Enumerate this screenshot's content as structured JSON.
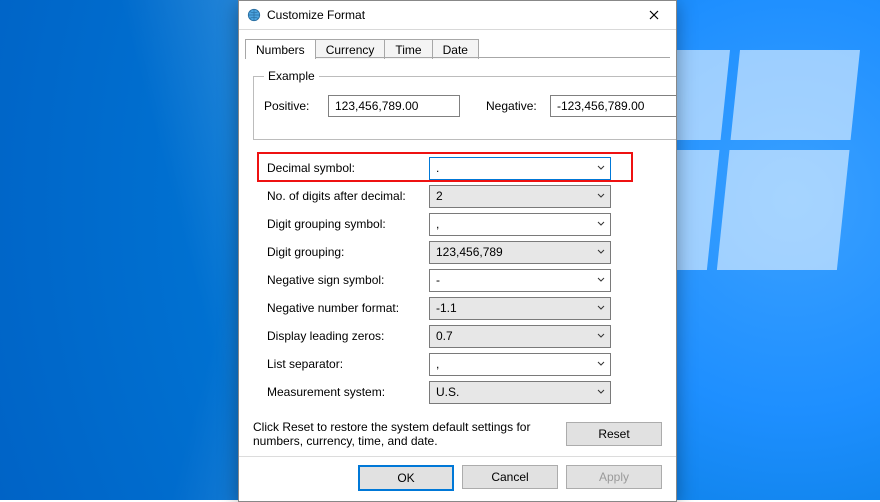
{
  "window": {
    "title": "Customize Format"
  },
  "tabs": [
    "Numbers",
    "Currency",
    "Time",
    "Date"
  ],
  "active_tab": 0,
  "example": {
    "legend": "Example",
    "positive_label": "Positive:",
    "positive_value": "123,456,789.00",
    "negative_label": "Negative:",
    "negative_value": "-123,456,789.00"
  },
  "settings": [
    {
      "label": "Decimal symbol:",
      "value": ".",
      "editable": true,
      "highlighted": true
    },
    {
      "label": "No. of digits after decimal:",
      "value": "2",
      "editable": false
    },
    {
      "label": "Digit grouping symbol:",
      "value": ",",
      "editable": true
    },
    {
      "label": "Digit grouping:",
      "value": "123,456,789",
      "editable": false
    },
    {
      "label": "Negative sign symbol:",
      "value": "-",
      "editable": true
    },
    {
      "label": "Negative number format:",
      "value": "-1.1",
      "editable": false
    },
    {
      "label": "Display leading zeros:",
      "value": "0.7",
      "editable": false
    },
    {
      "label": "List separator:",
      "value": ",",
      "editable": true
    },
    {
      "label": "Measurement system:",
      "value": "U.S.",
      "editable": false
    }
  ],
  "reset": {
    "hint": "Click Reset to restore the system default settings for numbers, currency, time, and date.",
    "button": "Reset"
  },
  "buttons": {
    "ok": "OK",
    "cancel": "Cancel",
    "apply": "Apply"
  }
}
